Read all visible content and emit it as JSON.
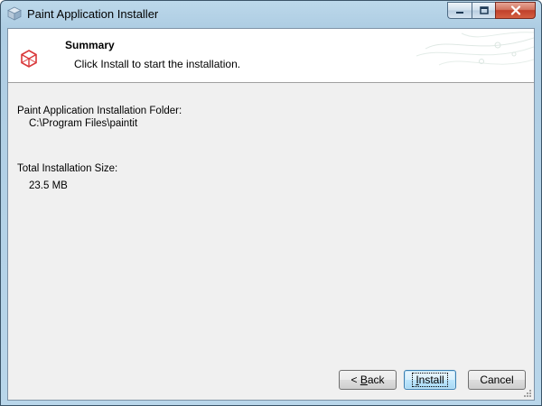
{
  "window": {
    "title": "Paint Application Installer"
  },
  "header": {
    "title": "Summary",
    "description": "Click Install to start the installation."
  },
  "details": {
    "folder_label": "Paint Application Installation Folder:",
    "folder_value": "C:\\Program Files\\paintit",
    "size_label": "Total Installation Size:",
    "size_value": "23.5 MB"
  },
  "buttons": {
    "back_pre": "< ",
    "back_mnemonic": "B",
    "back_post": "ack",
    "install_mnemonic": "I",
    "install_post": "nstall",
    "cancel": "Cancel"
  },
  "colors": {
    "header_icon": "#d9383a",
    "titlebar": "#aecde3",
    "close_button": "#c0402b"
  },
  "icons": {
    "app": "installer-box-icon",
    "header": "red-cube-icon",
    "minimize": "minimize-icon",
    "maximize": "maximize-icon",
    "close": "close-icon"
  }
}
